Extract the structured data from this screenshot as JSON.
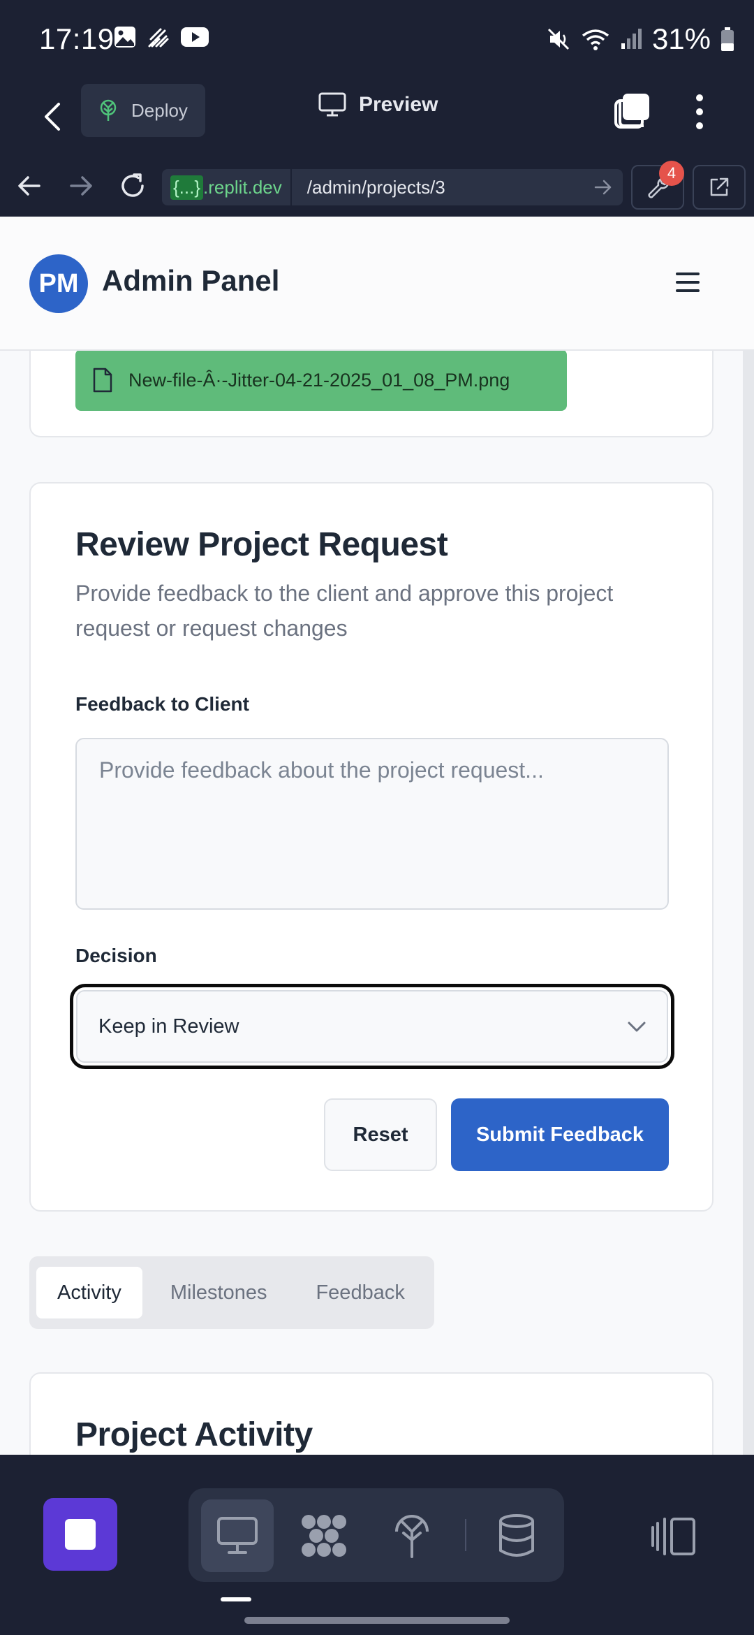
{
  "status_bar": {
    "time": "17:19",
    "battery": "31%"
  },
  "replit_bar": {
    "deploy_label": "Deploy",
    "preview_label": "Preview"
  },
  "url_bar": {
    "domain_brace": "{...}",
    "domain": ".replit.dev",
    "path": "/admin/projects/3",
    "tools_badge": "4"
  },
  "app": {
    "avatar_initials": "PM",
    "title": "Admin Panel"
  },
  "attachment": {
    "file_name": "New-file-Â·-Jitter-04-21-2025_01_08_PM.png"
  },
  "review": {
    "title": "Review Project Request",
    "description": "Provide feedback to the client and approve this project request or request changes",
    "feedback_label": "Feedback to Client",
    "feedback_placeholder": "Provide feedback about the project request...",
    "feedback_value": "",
    "decision_label": "Decision",
    "decision_value": "Keep in Review",
    "reset_label": "Reset",
    "submit_label": "Submit Feedback"
  },
  "tabs": [
    {
      "label": "Activity",
      "active": true
    },
    {
      "label": "Milestones",
      "active": false
    },
    {
      "label": "Feedback",
      "active": false
    }
  ],
  "activity": {
    "title": "Project Activity"
  },
  "colors": {
    "primary": "#2d64c8",
    "replit_bg": "#1c2133",
    "file_chip": "#5fbb7a",
    "stop_button": "#5c39d6",
    "badge": "#e5534b"
  },
  "icons": {
    "status_left": [
      "gallery-icon",
      "stylus-icon",
      "youtube-icon"
    ],
    "status_right": [
      "mute-icon",
      "wifi-icon",
      "signal-icon",
      "battery-icon"
    ],
    "dock": [
      "desktop-icon",
      "workspace-icon",
      "deploy-icon",
      "database-icon"
    ]
  }
}
